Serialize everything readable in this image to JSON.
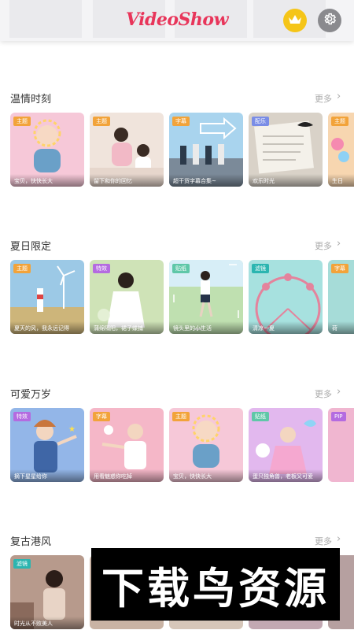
{
  "header": {
    "logo_text": "VideoShow",
    "crown_icon": "crown-icon",
    "settings_icon": "gear-icon"
  },
  "sections": [
    {
      "title": "温情时刻",
      "more": "更多",
      "cards": [
        {
          "tag": "主题",
          "tag_color": "#f2a33a",
          "caption": "宝贝，快快长大",
          "bg": "#f6c8d8"
        },
        {
          "tag": "主题",
          "tag_color": "#f2a33a",
          "caption": "留下和你的回忆",
          "bg": "#f0e4dc"
        },
        {
          "tag": "字幕",
          "tag_color": "#f2a33a",
          "caption": "超干货字幕合集~",
          "bg": "#a9d4ee"
        },
        {
          "tag": "配乐",
          "tag_color": "#7a8de6",
          "caption": "欢乐时光",
          "bg": "#d9d2c8"
        },
        {
          "tag": "主题",
          "tag_color": "#f2a33a",
          "caption": "生日",
          "bg": "#f7d6b0"
        }
      ]
    },
    {
      "title": "夏日限定",
      "more": "更多",
      "cards": [
        {
          "tag": "主题",
          "tag_color": "#f2a33a",
          "caption": "夏天的风，我永远记得",
          "bg": "#9cc9e6"
        },
        {
          "tag": "特效",
          "tag_color": "#b46be0",
          "caption": "蒲绵隔阳，裙子蝶捕",
          "bg": "#cfe3b7"
        },
        {
          "tag": "贴纸",
          "tag_color": "#5fc7a8",
          "caption": "镜头里的小生活",
          "bg": "#bfe0b0"
        },
        {
          "tag": "滤镜",
          "tag_color": "#2bb5b0",
          "caption": "清凉一夏",
          "bg": "#a7e1df"
        },
        {
          "tag": "字幕",
          "tag_color": "#f2a33a",
          "caption": "荷",
          "bg": "#a6dcd8"
        }
      ]
    },
    {
      "title": "可爱万岁",
      "more": "更多",
      "cards": [
        {
          "tag": "特效",
          "tag_color": "#b46be0",
          "caption": "摘下星星给你",
          "bg": "#93b6e8"
        },
        {
          "tag": "字幕",
          "tag_color": "#f2a33a",
          "caption": "用看魅惑你吃掉",
          "bg": "#f5b7c8"
        },
        {
          "tag": "主题",
          "tag_color": "#f2a33a",
          "caption": "宝贝，快快长大",
          "bg": "#f6c8d8"
        },
        {
          "tag": "贴纸",
          "tag_color": "#5fc7a8",
          "caption": "蛋只独角兽，老板又可爱",
          "bg": "#e2b8ee"
        },
        {
          "tag": "PIP",
          "tag_color": "#b46be0",
          "caption": "",
          "bg": "#f0b6d0"
        }
      ]
    },
    {
      "title": "复古港风",
      "more": "更多",
      "cards": [
        {
          "tag": "滤镜",
          "tag_color": "#2bb5b0",
          "caption": "时光从不败美人",
          "bg": "#b79a8c"
        },
        {
          "tag": "",
          "tag_color": "#000000",
          "caption": "",
          "bg": "#c9b3a4"
        },
        {
          "tag": "",
          "tag_color": "#000000",
          "caption": "",
          "bg": "#d6c6b9"
        },
        {
          "tag": "",
          "tag_color": "#000000",
          "caption": "",
          "bg": "#c2a8b2"
        },
        {
          "tag": "",
          "tag_color": "#000000",
          "caption": "",
          "bg": "#b6a0a0"
        }
      ]
    }
  ],
  "watermark": {
    "text": "下载鸟资源"
  }
}
